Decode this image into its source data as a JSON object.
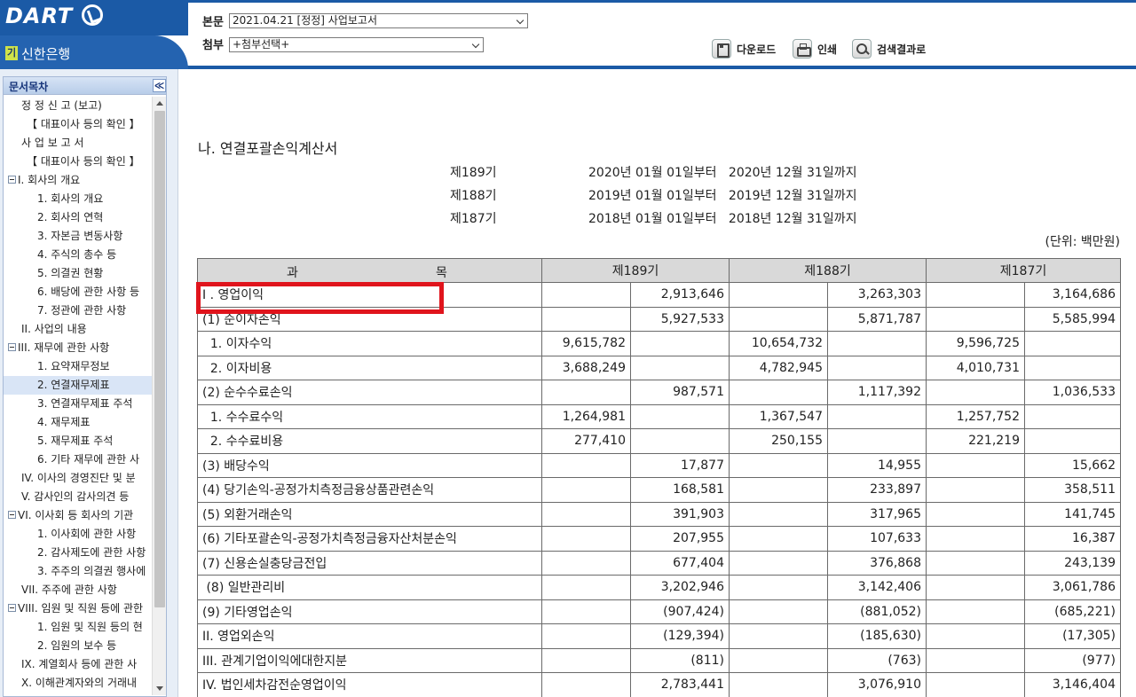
{
  "header": {
    "logo": "DART",
    "company_tag": "기",
    "company": "신한은행",
    "doc_label": "본문",
    "doc_value": "2021.04.21  [정정] 사업보고서",
    "attach_label": "첨부",
    "attach_value": "+첨부선택+",
    "download": "다운로드",
    "print": "인쇄",
    "search_results": "검색결과로"
  },
  "sidebar": {
    "title": "문서목차",
    "collapse": "≪",
    "items": [
      {
        "label": "정 정 신 고 (보고)",
        "indent": 1
      },
      {
        "label": "【 대표이사 등의 확인 】",
        "indent": 2
      },
      {
        "label": "사 업 보 고 서",
        "indent": 1
      },
      {
        "label": "【 대표이사 등의 확인 】",
        "indent": 2
      },
      {
        "label": "I. 회사의 개요",
        "indent": 0,
        "tree": true
      },
      {
        "label": "1. 회사의 개요",
        "indent": 3
      },
      {
        "label": "2. 회사의 연혁",
        "indent": 3
      },
      {
        "label": "3. 자본금 변동사항",
        "indent": 3
      },
      {
        "label": "4. 주식의 총수 등",
        "indent": 3
      },
      {
        "label": "5. 의결권 현황",
        "indent": 3
      },
      {
        "label": "6. 배당에 관한 사항 등",
        "indent": 3
      },
      {
        "label": "7. 정관에 관한 사항",
        "indent": 3
      },
      {
        "label": "II. 사업의 내용",
        "indent": 1
      },
      {
        "label": "III. 재무에 관한 사항",
        "indent": 0,
        "tree": true
      },
      {
        "label": "1. 요약재무정보",
        "indent": 3
      },
      {
        "label": "2. 연결재무제표",
        "indent": 3,
        "selected": true
      },
      {
        "label": "3. 연결재무제표 주석",
        "indent": 3
      },
      {
        "label": "4. 재무제표",
        "indent": 3
      },
      {
        "label": "5. 재무제표 주석",
        "indent": 3
      },
      {
        "label": "6. 기타 재무에 관한 사",
        "indent": 3
      },
      {
        "label": "IV. 이사의 경영진단 및 분",
        "indent": 1
      },
      {
        "label": "V. 감사인의 감사의견 등",
        "indent": 1
      },
      {
        "label": "VI. 이사회 등 회사의 기관",
        "indent": 0,
        "tree": true
      },
      {
        "label": "1. 이사회에 관한 사항",
        "indent": 3
      },
      {
        "label": "2. 감사제도에 관한 사항",
        "indent": 3
      },
      {
        "label": "3. 주주의 의결권 행사에",
        "indent": 3
      },
      {
        "label": "VII. 주주에 관한 사항",
        "indent": 1
      },
      {
        "label": "VIII. 임원 및 직원 등에 관한",
        "indent": 0,
        "tree": true
      },
      {
        "label": "1. 임원 및 직원 등의 현",
        "indent": 3
      },
      {
        "label": "2. 임원의 보수 등",
        "indent": 3
      },
      {
        "label": "IX. 계열회사 등에 관한 사",
        "indent": 1
      },
      {
        "label": "X. 이해관계자와의 거래내",
        "indent": 1
      }
    ]
  },
  "content": {
    "section_title": "나. 연결포괄손익계산서",
    "periods": [
      {
        "name": "제189기",
        "range": "2020년 01월 01일부터   2020년 12월 31일까지"
      },
      {
        "name": "제188기",
        "range": "2019년 01월 01일부터   2019년 12월 31일까지"
      },
      {
        "name": "제187기",
        "range": "2018년 01월 01일부터   2018년 12월 31일까지"
      }
    ],
    "unit": "(단위: 백만원)",
    "table": {
      "header_a": "과",
      "header_b": "목",
      "columns": [
        "제189기",
        "제188기",
        "제187기"
      ],
      "rows": [
        {
          "label": "I . 영업이익",
          "v": [
            "",
            "2,913,646",
            "",
            "3,263,303",
            "",
            "3,164,686"
          ]
        },
        {
          "label": "(1) 순이자손익",
          "v": [
            "",
            "5,927,533",
            "",
            "5,871,787",
            "",
            "5,585,994"
          ]
        },
        {
          "label": "  1. 이자수익",
          "v": [
            "9,615,782",
            "",
            "10,654,732",
            "",
            "9,596,725",
            ""
          ]
        },
        {
          "label": "  2. 이자비용",
          "v": [
            "3,688,249",
            "",
            "4,782,945",
            "",
            "4,010,731",
            ""
          ]
        },
        {
          "label": "(2) 순수수료손익",
          "v": [
            "",
            "987,571",
            "",
            "1,117,392",
            "",
            "1,036,533"
          ]
        },
        {
          "label": "  1. 수수료수익",
          "v": [
            "1,264,981",
            "",
            "1,367,547",
            "",
            "1,257,752",
            ""
          ]
        },
        {
          "label": "  2. 수수료비용",
          "v": [
            "277,410",
            "",
            "250,155",
            "",
            "221,219",
            ""
          ]
        },
        {
          "label": "(3) 배당수익",
          "v": [
            "",
            "17,877",
            "",
            "14,955",
            "",
            "15,662"
          ]
        },
        {
          "label": "(4) 당기손익-공정가치측정금융상품관련손익",
          "v": [
            "",
            "168,581",
            "",
            "233,897",
            "",
            "358,511"
          ]
        },
        {
          "label": "(5) 외환거래손익",
          "v": [
            "",
            "391,903",
            "",
            "317,965",
            "",
            "141,745"
          ]
        },
        {
          "label": "(6) 기타포괄손익-공정가치측정금융자산처분손익",
          "v": [
            "",
            "207,955",
            "",
            "107,633",
            "",
            "16,387"
          ]
        },
        {
          "label": "(7) 신용손실충당금전입",
          "v": [
            "",
            "677,404",
            "",
            "376,868",
            "",
            "243,139"
          ]
        },
        {
          "label": " (8) 일반관리비",
          "v": [
            "",
            "3,202,946",
            "",
            "3,142,406",
            "",
            "3,061,786"
          ]
        },
        {
          "label": "(9) 기타영업손익",
          "v": [
            "",
            "(907,424)",
            "",
            "(881,052)",
            "",
            "(685,221)"
          ]
        },
        {
          "label": "II. 영업외손익",
          "v": [
            "",
            "(129,394)",
            "",
            "(185,630)",
            "",
            "(17,305)"
          ]
        },
        {
          "label": "III. 관계기업이익에대한지분",
          "v": [
            "",
            "(811)",
            "",
            "(763)",
            "",
            "(977)"
          ]
        },
        {
          "label": "IV. 법인세차감전순영업이익",
          "v": [
            "",
            "2,783,441",
            "",
            "3,076,910",
            "",
            "3,146,404"
          ]
        }
      ]
    }
  }
}
